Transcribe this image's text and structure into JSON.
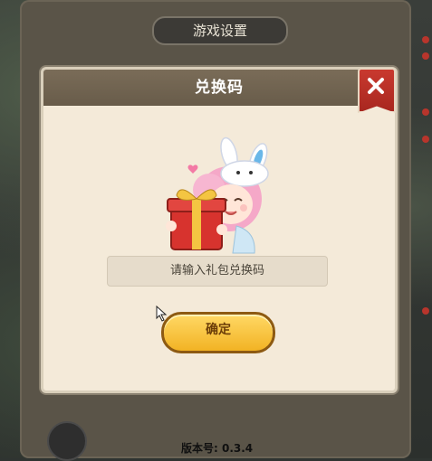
{
  "settings": {
    "title": "游戏设置",
    "version_label": "版本号: 0.3.4"
  },
  "dialog": {
    "title": "兑换码",
    "input_placeholder": "请输入礼包兑换码",
    "confirm_label": "确定",
    "close_icon": "close-icon"
  },
  "colors": {
    "accent_gold": "#f2b324",
    "close_red": "#c9392f",
    "header_brown": "#7a6c58"
  }
}
